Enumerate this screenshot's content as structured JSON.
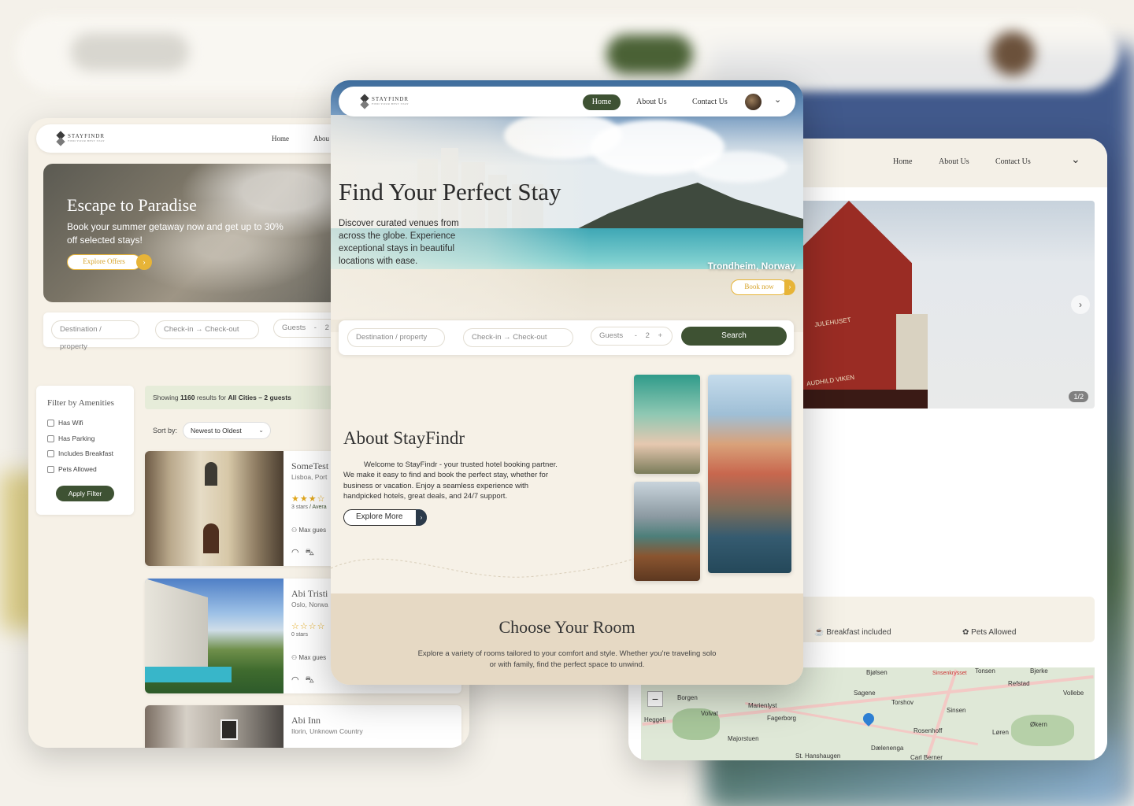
{
  "brand": {
    "name": "STAYFINDR",
    "tagline": "FIND YOUR BEST STAY"
  },
  "colors": {
    "primary": "#3e5233",
    "accent": "#e7b437",
    "cream": "#f6f1e7",
    "sand": "#e6d9c4"
  },
  "left_page": {
    "nav": {
      "home": "Home",
      "about": "Abou"
    },
    "hero": {
      "title": "Escape to Paradise",
      "subtitle": "Book your summer getaway now and get up to 30% off selected stays!",
      "button": "Explore Offers"
    },
    "search": {
      "destination": "Destination / property",
      "dates": "Check-in → Check-out",
      "guests_label": "Guests",
      "minus": "-",
      "guests_count": "2"
    },
    "filter": {
      "title": "Filter by Amenities",
      "options": [
        "Has Wifi",
        "Has Parking",
        "Includes Breakfast",
        "Pets Allowed"
      ],
      "apply": "Apply Filter"
    },
    "results": {
      "prefix": "Showing",
      "count": "1160",
      "mid": "results for",
      "cities": "All Cities",
      "suffix": "– 2 guests"
    },
    "sort": {
      "label": "Sort by:",
      "value": "Newest to Oldest"
    },
    "hotels": [
      {
        "name": "SomeTest",
        "location": "Lisboa, Port",
        "stars_glyph": "★★★☆",
        "stars_text": "3 stars",
        "rating_text": "/ Avera",
        "max_guests": "Max gues"
      },
      {
        "name": "Abi Tristi",
        "location": "Oslo, Norwa",
        "stars_glyph": "☆☆☆☆",
        "stars_text": "0 stars",
        "max_guests": "Max gues"
      },
      {
        "name": "Abi Inn",
        "location": "Ilorin, Unknown Country"
      }
    ]
  },
  "center_page": {
    "nav": {
      "home": "Home",
      "about": "About Us",
      "contact": "Contact Us",
      "chevron": "⌄"
    },
    "hero": {
      "title": "Find Your Perfect Stay",
      "subtitle": "Discover curated venues from across the globe. Experience exceptional stays in beautiful locations with ease.",
      "city": "Trondheim, Norway",
      "book": "Book now"
    },
    "search": {
      "destination": "Destination / property",
      "dates": "Check-in → Check-out",
      "guests_label": "Guests",
      "minus": "-",
      "guests_count": "2",
      "plus": "+",
      "button": "Search"
    },
    "about": {
      "title": "About StayFindr",
      "body": "Welcome to StayFindr - your trusted hotel booking partner. We make it easy to find and book the perfect stay, whether for business or vacation. Enjoy a seamless experience with handpicked hotels, great deals, and 24/7 support.",
      "button": "Explore More"
    },
    "rooms": {
      "title": "Choose Your Room",
      "subtitle": "Explore a variety of rooms tailored to your comfort and style. Whether you're traveling solo or with family, find the perfect space to unwind."
    }
  },
  "right_page": {
    "nav": {
      "home": "Home",
      "about": "About Us",
      "contact": "Contact Us",
      "chevron": "⌄"
    },
    "gallery": {
      "pager": "1/2",
      "sign1": "JULEHUSET",
      "sign2": "AUDHILD VIKEN"
    },
    "amenities": [
      "Breakfast included",
      "Pets Allowed"
    ],
    "map": {
      "zoom_out": "−",
      "places": [
        "Bjølsen",
        "Sinsenkrysset",
        "Torshov",
        "Refstad",
        "Vollebe",
        "Sagene",
        "Borgen",
        "Heggeli",
        "Volvat",
        "Marienlyst",
        "Fagerborg",
        "Sinsen",
        "Rosenhoff",
        "Løren",
        "Økern",
        "Majorstuen",
        "Dælenenga",
        "St. Hanshaugen",
        "Carl Berner",
        "Tonsen",
        "Bjerke"
      ]
    }
  }
}
